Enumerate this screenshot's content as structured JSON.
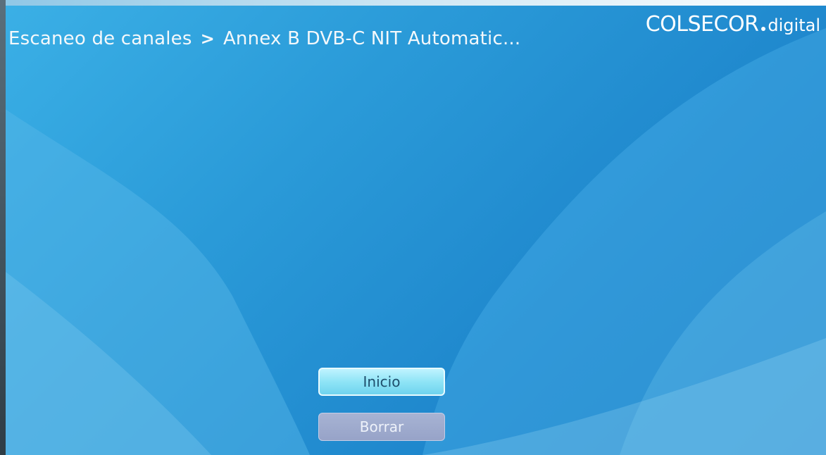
{
  "header": {
    "breadcrumb_section": "Escaneo de canales",
    "breadcrumb_separator": ">",
    "breadcrumb_current": "Annex B DVB-C NIT Automatic..."
  },
  "logo": {
    "brand": "COLSECOR",
    "sub": "digital"
  },
  "buttons": {
    "start_label": "Inicio",
    "clear_label": "Borrar"
  },
  "colors": {
    "background": "#2a9ad8",
    "focused_button": "#8fe4f6",
    "unfocused_button": "#a0acd0",
    "text": "#ffffff"
  }
}
